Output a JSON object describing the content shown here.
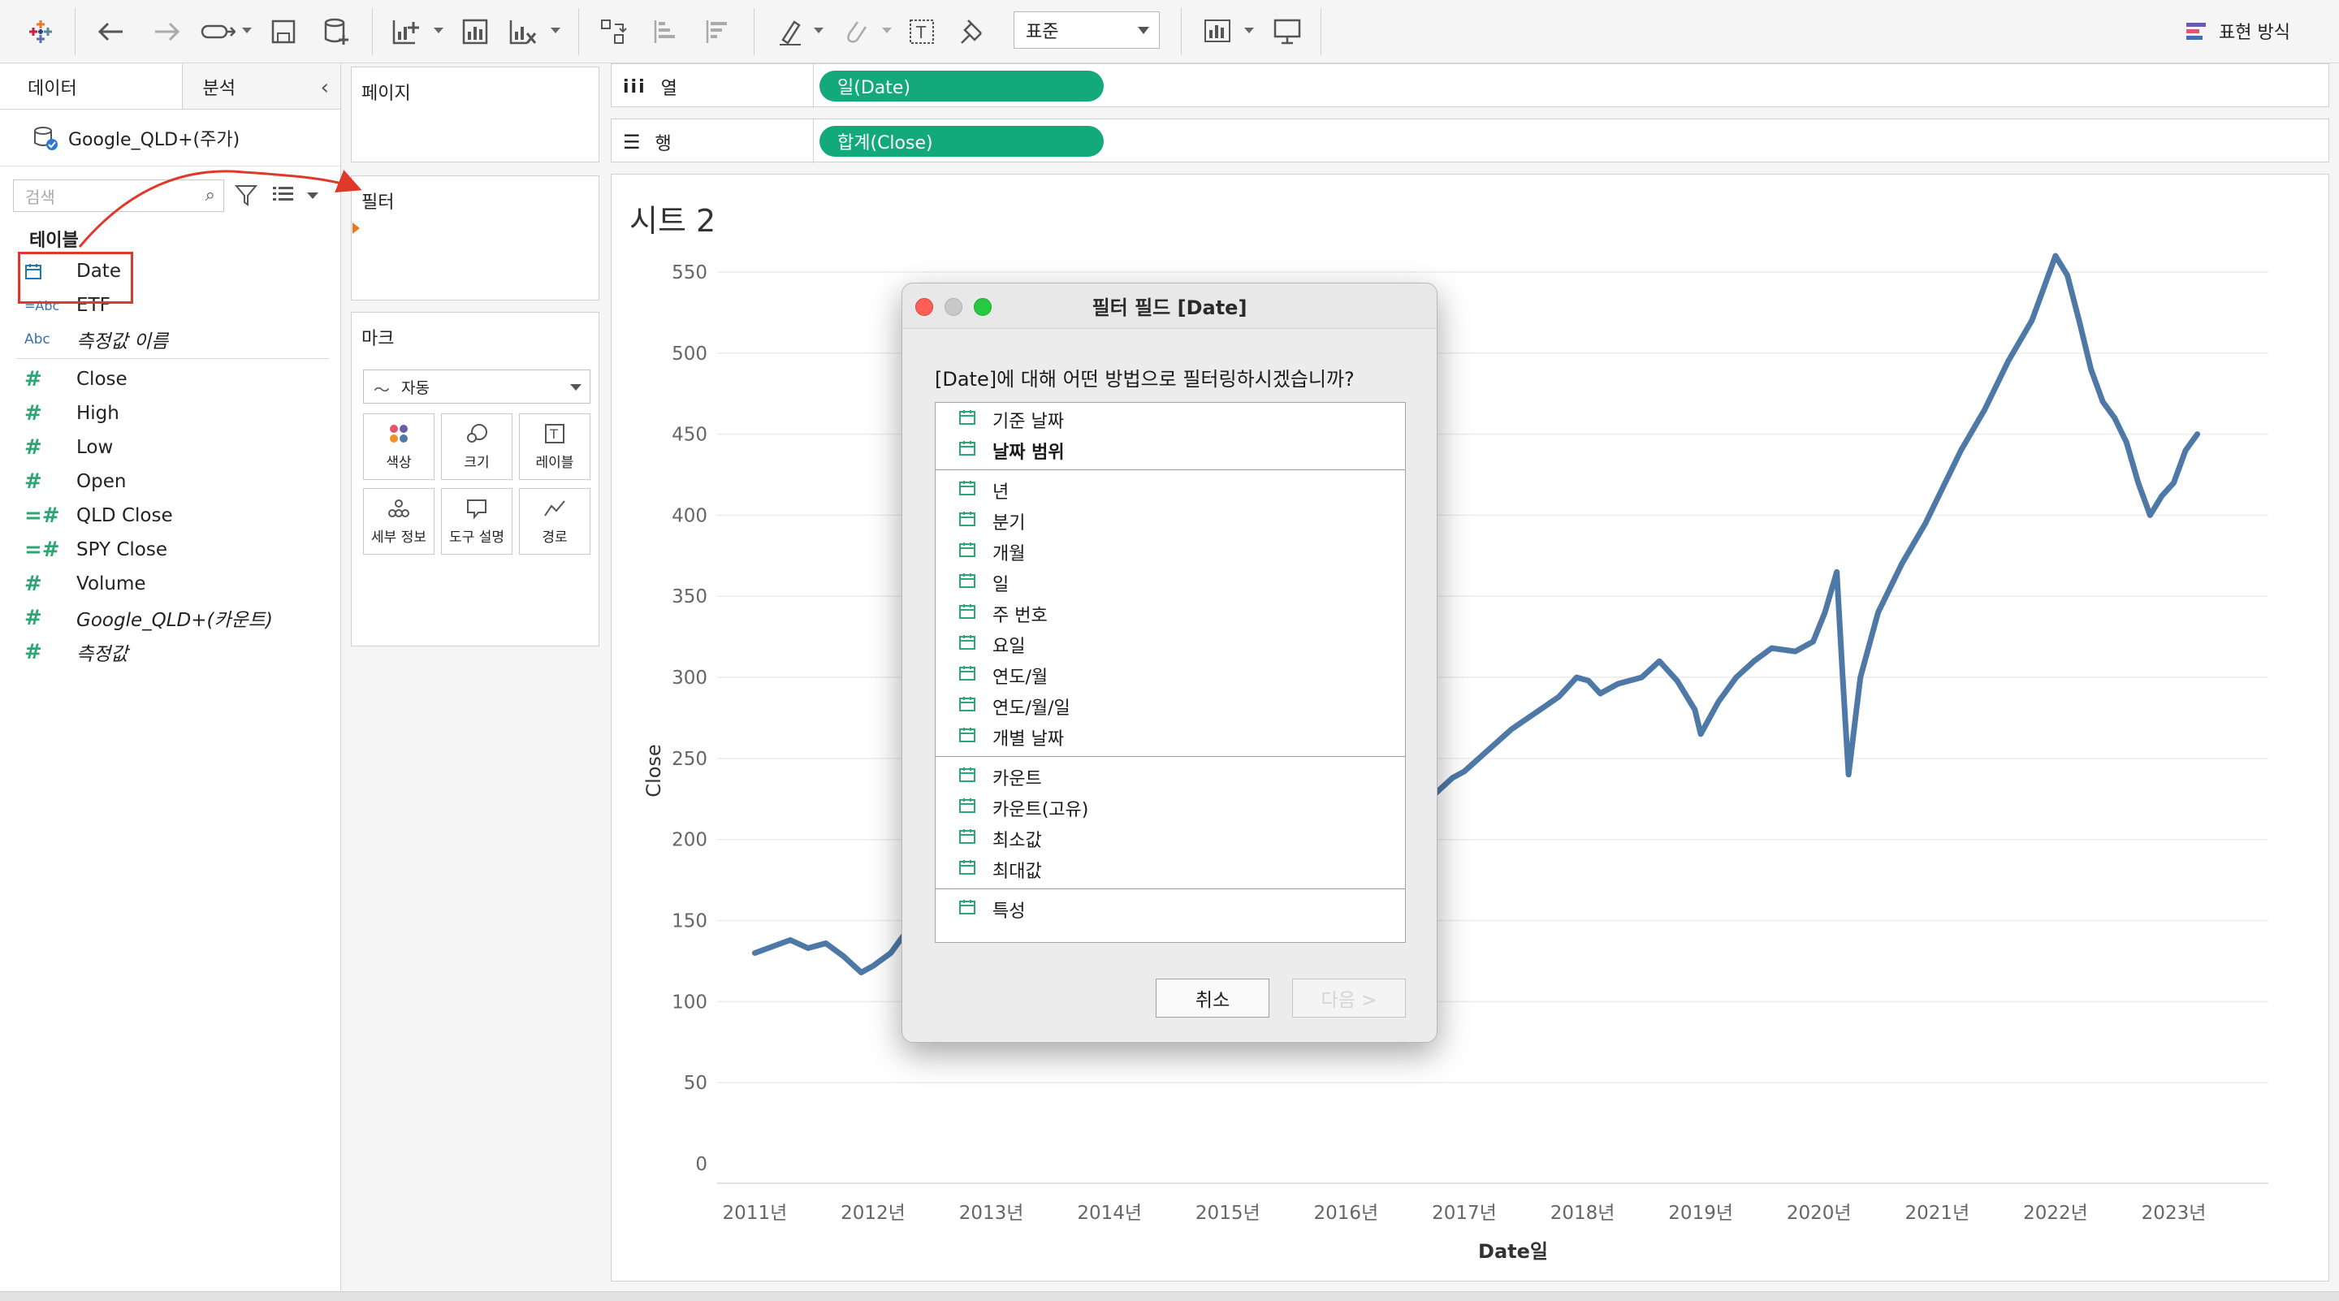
{
  "toolbar": {
    "mark_type_select": "표준",
    "show_me_label": "표현 방식"
  },
  "data_pane": {
    "tab_data": "데이터",
    "tab_analysis": "분석",
    "datasource_name": "Google_QLD+(주가)",
    "search_placeholder": "검색",
    "section_tables": "테이블",
    "fields": [
      {
        "name": "Date",
        "type": "date",
        "italic": false
      },
      {
        "name": "ETF",
        "type": "abc-calc",
        "italic": false
      },
      {
        "name": "측정값 이름",
        "type": "abc",
        "italic": true
      },
      {
        "name": "Close",
        "type": "measure",
        "italic": false
      },
      {
        "name": "High",
        "type": "measure",
        "italic": false
      },
      {
        "name": "Low",
        "type": "measure",
        "italic": false
      },
      {
        "name": "Open",
        "type": "measure",
        "italic": false
      },
      {
        "name": "QLD Close",
        "type": "measure-calc",
        "italic": false
      },
      {
        "name": "SPY Close",
        "type": "measure-calc",
        "italic": false
      },
      {
        "name": "Volume",
        "type": "measure",
        "italic": false
      },
      {
        "name": "Google_QLD+(카운트)",
        "type": "measure",
        "italic": true
      },
      {
        "name": "측정값",
        "type": "measure",
        "italic": true
      }
    ]
  },
  "cards": {
    "pages_title": "페이지",
    "filters_title": "필터",
    "marks_title": "마크",
    "marks_type": "자동",
    "mark_buttons": [
      "색상",
      "크기",
      "레이블",
      "세부 정보",
      "도구 설명",
      "경로"
    ]
  },
  "shelves": {
    "columns_label": "열",
    "rows_label": "행",
    "columns_pill": "일(Date)",
    "rows_pill": "합계(Close)"
  },
  "sheet": {
    "title": "시트 2"
  },
  "chart_data": {
    "type": "line",
    "xlabel": "Date일",
    "ylabel": "Close",
    "x_ticks": [
      "2011년",
      "2012년",
      "2013년",
      "2014년",
      "2015년",
      "2016년",
      "2017년",
      "2018년",
      "2019년",
      "2020년",
      "2021년",
      "2022년",
      "2023년"
    ],
    "y_ticks": [
      0,
      50,
      100,
      150,
      200,
      250,
      300,
      350,
      400,
      450,
      500,
      550
    ],
    "ylim": [
      0,
      565
    ],
    "xlim": [
      2010.75,
      2023.8
    ],
    "grid": true,
    "color": "#4e79a7",
    "series": [
      {
        "x": [
          2011.0,
          2011.15,
          2011.3,
          2011.45,
          2011.6,
          2011.75,
          2011.9,
          2012.0,
          2012.15,
          2012.3,
          2012.45,
          2012.6,
          2012.75,
          2012.9,
          2013.0,
          2013.2,
          2013.4,
          2013.6,
          2013.8,
          2014.0,
          2014.2,
          2014.4,
          2014.6,
          2014.8,
          2015.0,
          2015.2,
          2015.4,
          2015.6,
          2015.75,
          2015.9,
          2016.0,
          2016.15,
          2016.3,
          2016.45,
          2016.6,
          2016.75,
          2016.9,
          2017.0,
          2017.2,
          2017.4,
          2017.6,
          2017.8,
          2017.95,
          2018.05,
          2018.15,
          2018.3,
          2018.5,
          2018.65,
          2018.8,
          2018.95,
          2019.0,
          2019.15,
          2019.3,
          2019.45,
          2019.6,
          2019.8,
          2019.95,
          2020.05,
          2020.15,
          2020.2,
          2020.25,
          2020.35,
          2020.5,
          2020.7,
          2020.9,
          2021.0,
          2021.2,
          2021.4,
          2021.6,
          2021.8,
          2021.9,
          2022.0,
          2022.1,
          2022.2,
          2022.3,
          2022.4,
          2022.5,
          2022.6,
          2022.7,
          2022.8,
          2022.9,
          2023.0,
          2023.1,
          2023.2
        ],
        "y": [
          130,
          134,
          138,
          133,
          136,
          128,
          118,
          122,
          130,
          145,
          160,
          168,
          172,
          178,
          185,
          192,
          200,
          206,
          212,
          214,
          210,
          206,
          203,
          207,
          212,
          215,
          218,
          220,
          214,
          210,
          212,
          222,
          226,
          224,
          222,
          228,
          238,
          242,
          255,
          268,
          278,
          288,
          300,
          298,
          290,
          296,
          300,
          310,
          298,
          280,
          265,
          285,
          300,
          310,
          318,
          316,
          322,
          340,
          365,
          300,
          240,
          300,
          340,
          370,
          395,
          410,
          440,
          465,
          495,
          520,
          540,
          560,
          548,
          520,
          490,
          470,
          460,
          445,
          420,
          400,
          412,
          420,
          440,
          450
        ]
      }
    ]
  },
  "dialog": {
    "title": "필터 필드 [Date]",
    "question": "[Date]에 대해 어떤 방법으로 필터링하시겠습니까?",
    "groups": [
      [
        {
          "label": "기준 날짜",
          "bold": false
        },
        {
          "label": "날짜 범위",
          "bold": true
        }
      ],
      [
        {
          "label": "년",
          "bold": false
        },
        {
          "label": "분기",
          "bold": false
        },
        {
          "label": "개월",
          "bold": false
        },
        {
          "label": "일",
          "bold": false
        },
        {
          "label": "주 번호",
          "bold": false
        },
        {
          "label": "요일",
          "bold": false
        },
        {
          "label": "연도/월",
          "bold": false
        },
        {
          "label": "연도/월/일",
          "bold": false
        },
        {
          "label": "개별 날짜",
          "bold": false
        }
      ],
      [
        {
          "label": "카운트",
          "bold": false
        },
        {
          "label": "카운트(고유)",
          "bold": false
        },
        {
          "label": "최소값",
          "bold": false
        },
        {
          "label": "최대값",
          "bold": false
        }
      ],
      [
        {
          "label": "특성",
          "bold": false
        }
      ]
    ],
    "cancel_label": "취소",
    "next_label": "다음 >"
  },
  "colors": {
    "pill": "#14a97a",
    "line": "#4e79a7",
    "highlight": "#e0392b"
  }
}
